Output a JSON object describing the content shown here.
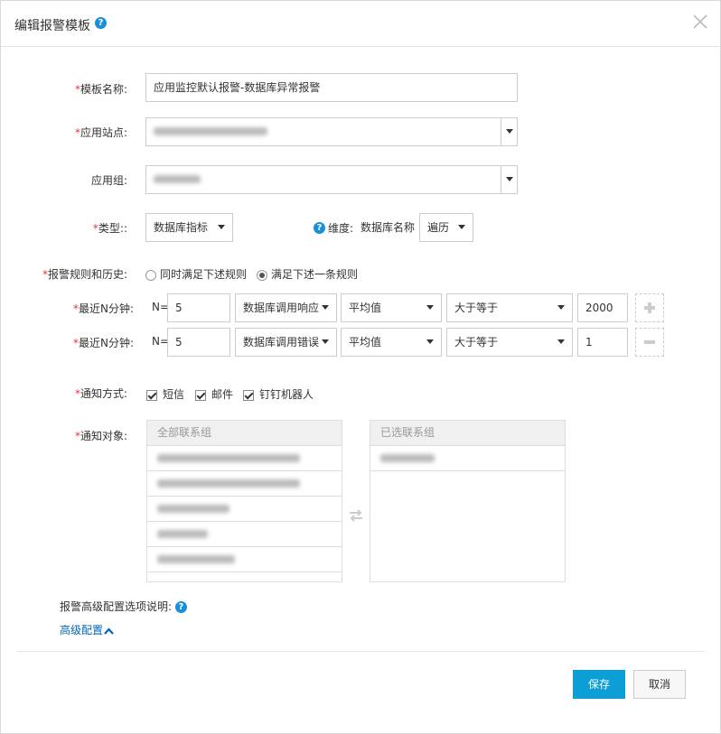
{
  "dialog": {
    "title": "编辑报警模板",
    "help_icon": "question-circle-icon",
    "close_icon": "close-icon"
  },
  "form": {
    "template_name": {
      "required_mark": "*",
      "label": "模板名称:",
      "value": "应用监控默认报警-数据库异常报警"
    },
    "app_site": {
      "required_mark": "*",
      "label": "应用站点:"
    },
    "app_group": {
      "label": "应用组:"
    },
    "type": {
      "required_mark": "*",
      "label": "类型::",
      "value": "数据库指标"
    },
    "dimension": {
      "label": "维度:",
      "name": "数据库名称",
      "value": "遍历"
    },
    "rule": {
      "required_mark": "*",
      "label": "报警规则和历史:",
      "options": [
        {
          "label": "同时满足下述规则",
          "selected": false
        },
        {
          "label": "满足下述一条规则",
          "selected": true
        }
      ]
    },
    "conditions": [
      {
        "required_mark": "*",
        "label": "最近N分钟:",
        "n_prefix": "N=",
        "n_value": "5",
        "metric": "数据库调用响应",
        "aggregate": "平均值",
        "operator": "大于等于",
        "threshold": "2000",
        "action_icon": "plus-icon"
      },
      {
        "required_mark": "*",
        "label": "最近N分钟:",
        "n_prefix": "N=",
        "n_value": "5",
        "metric": "数据库调用错误",
        "aggregate": "平均值",
        "operator": "大于等于",
        "threshold": "1",
        "action_icon": "minus-icon"
      }
    ],
    "notify_method": {
      "required_mark": "*",
      "label": "通知方式:",
      "options": [
        {
          "label": "短信",
          "checked": true
        },
        {
          "label": "邮件",
          "checked": true
        },
        {
          "label": "钉钉机器人",
          "checked": true
        }
      ]
    },
    "notify_target": {
      "required_mark": "*",
      "label": "通知对象:",
      "all_header": "全部联系组",
      "selected_header": "已选联系组",
      "transfer_icon": "transfer-arrows-icon"
    },
    "advanced_help": "报警高级配置选项说明:",
    "advanced_link": "高级配置"
  },
  "footer": {
    "save": "保存",
    "cancel": "取消"
  },
  "colors": {
    "primary": "#0c9ed4",
    "required": "#e4393c",
    "link": "#0066b8"
  }
}
